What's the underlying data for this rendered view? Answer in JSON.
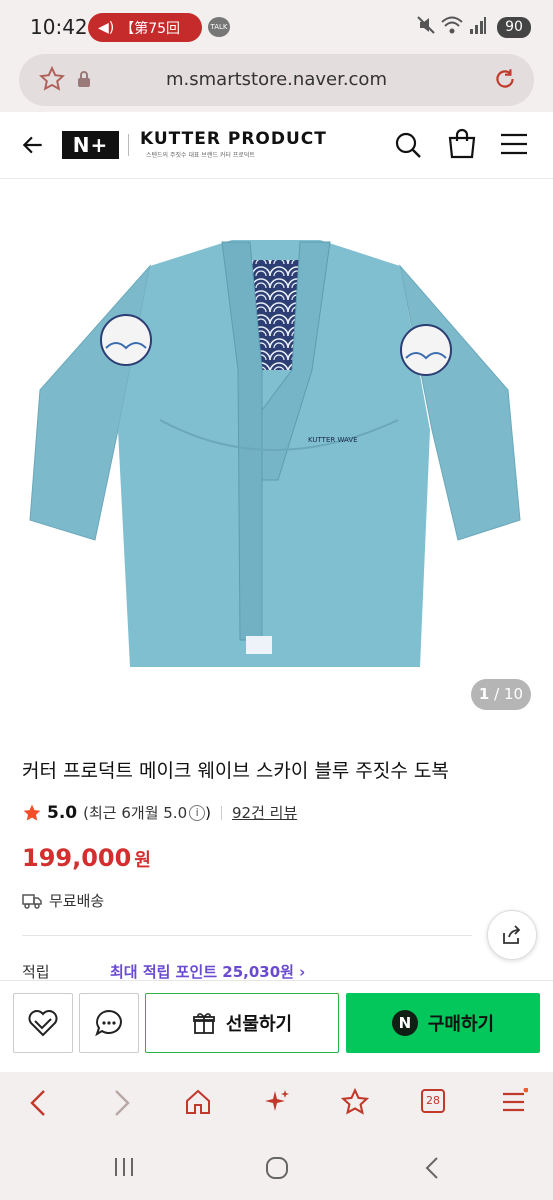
{
  "status": {
    "time": "10:42",
    "notification": "【第75回",
    "talk_badge": "TALK",
    "battery": "90"
  },
  "browser": {
    "url": "m.smartstore.naver.com"
  },
  "header": {
    "logo": "N+",
    "brand": "KUTTER PRODUCT",
    "brand_sub": "스텐드의 주짓수 대표 브랜드 커터 프로덕트"
  },
  "gallery": {
    "current": "1",
    "total": "/ 10",
    "chest_label": "KUTTER WAVE"
  },
  "product": {
    "title": "커터 프로덕트 메이크 웨이브 스카이 블루 주짓수 도복",
    "rating": "5.0",
    "recent_rating": "(최근 6개월 5.0",
    "recent_close": ")",
    "info_glyph": "i",
    "reviews": "92건 리뷰",
    "price": "199,000",
    "currency": "원",
    "shipping": "무료배송",
    "points_label": "적립",
    "points_value": "최대 적립 포인트 25,030원 ›"
  },
  "buybar": {
    "gift_label": "선물하기",
    "buy_label": "구매하기",
    "buy_badge": "N"
  },
  "toolbar": {
    "tabs_count": "28"
  },
  "colors": {
    "price": "#d32f2f",
    "buy": "#03c75a",
    "points": "#6a4ad1",
    "gi": "#7cb9cb",
    "browser_accent": "#c0392b"
  },
  "icons": [
    "star-icon",
    "lock-icon",
    "reload-icon",
    "back-arrow-icon",
    "search-icon",
    "bag-icon",
    "menu-icon",
    "share-icon",
    "heart-icon",
    "chat-icon",
    "gift-icon",
    "truck-icon"
  ]
}
